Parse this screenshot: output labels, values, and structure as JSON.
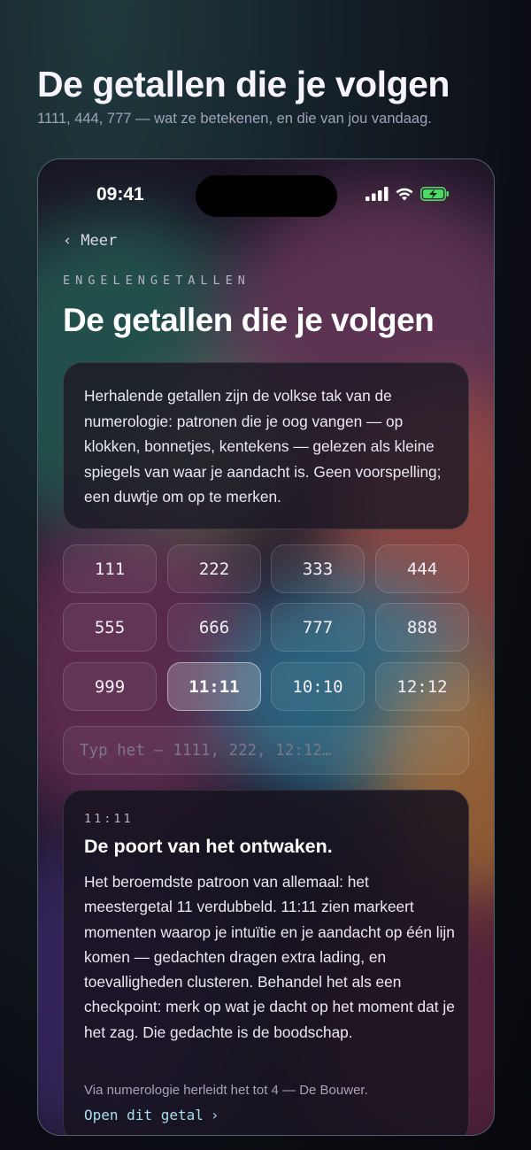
{
  "header": {
    "title": "De getallen die je volgen",
    "subtitle": "1111, 444, 777 — wat ze betekenen, en die van jou vandaag."
  },
  "status_bar": {
    "time": "09:41",
    "icons": [
      "cellular-signal-icon",
      "wifi-icon",
      "battery-charging-icon"
    ]
  },
  "nav": {
    "back_chevron": "‹",
    "back_label": "Meer"
  },
  "screen": {
    "eyebrow": "ENGELENGETALLEN",
    "title": "De getallen die je volgen",
    "intro": "Herhalende getallen zijn de volkse tak van de numerologie: patronen die je oog vangen — op klokken, bonnetjes, kentekens — gelezen als kleine spiegels van waar je aandacht is. Geen voorspelling; een duwtje om op te merken."
  },
  "numbers": [
    "111",
    "222",
    "333",
    "444",
    "555",
    "666",
    "777",
    "888",
    "999",
    "11:11",
    "10:10",
    "12:12"
  ],
  "selected_number": "11:11",
  "search": {
    "placeholder": "Typ het — 1111, 222, 12:12…",
    "value": ""
  },
  "detail": {
    "number": "11:11",
    "heading": "De poort van het ontwaken.",
    "body": "Het beroemdste patroon van allemaal: het meestergetal 11 verdubbeld. 11:11 zien markeert momenten waarop je intuïtie en je aandacht op één lijn komen — gedachten dragen extra lading, en toevalligheden clusteren. Behandel het als een checkpoint: merk op wat je dacht op het moment dat je het zag. Die gedachte is de boodschap.",
    "note": "Via numerologie herleidt het tot 4 — De Bouwer.",
    "link_label": "Open dit getal",
    "link_chevron": "›"
  },
  "colors": {
    "accent_link": "#a6dfee",
    "battery": "#4cd964"
  }
}
